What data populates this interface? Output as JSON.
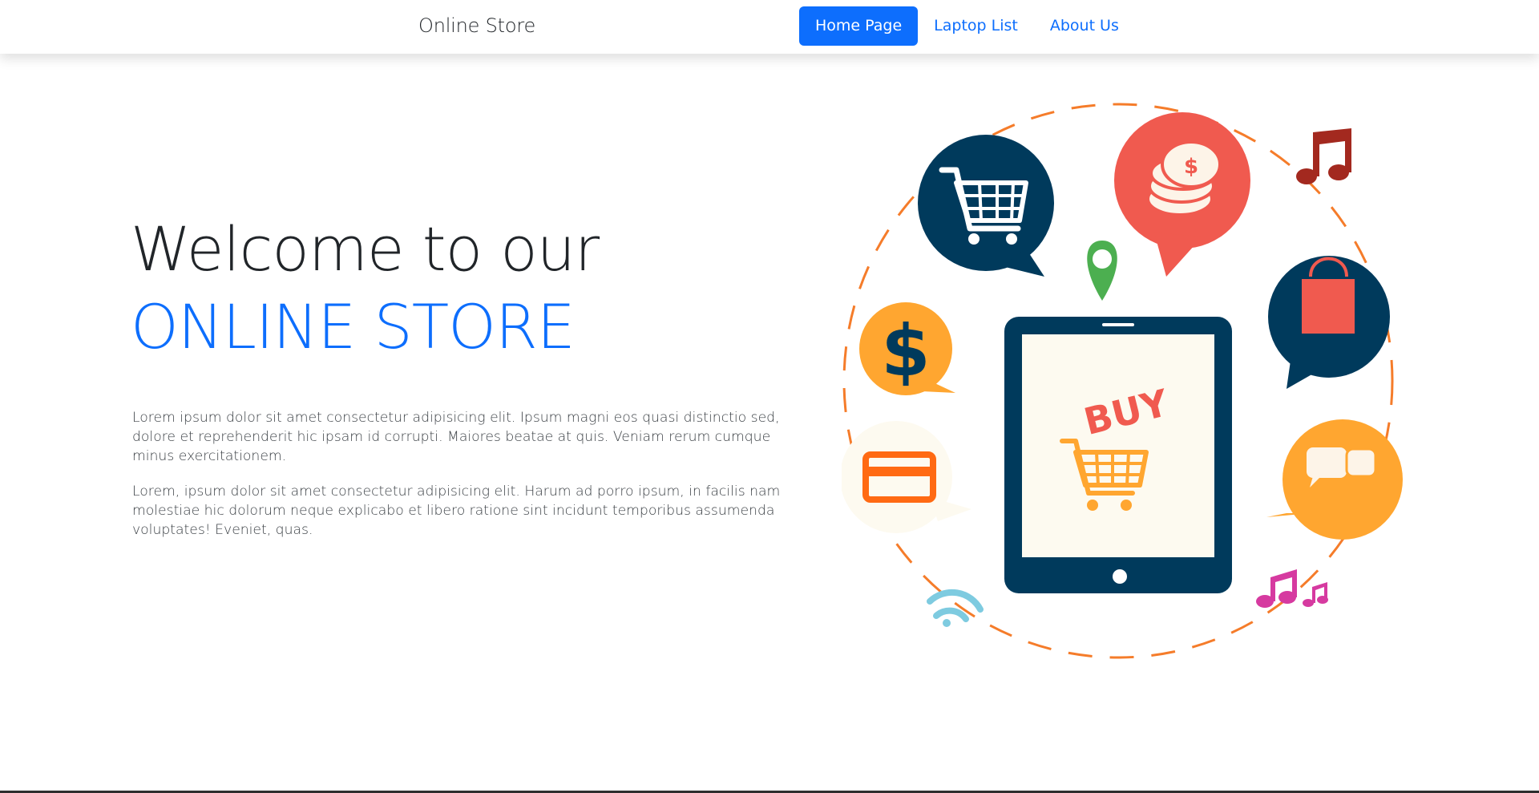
{
  "navbar": {
    "brand": "Online Store",
    "links": [
      {
        "label": "Home Page",
        "active": true
      },
      {
        "label": "Laptop List",
        "active": false
      },
      {
        "label": "About Us",
        "active": false
      }
    ]
  },
  "hero": {
    "title_line1": "Welcome to our",
    "title_line2": "ONLINE STORE",
    "paragraph1": "Lorem ipsum dolor sit amet consectetur adipisicing elit. Ipsum magni eos quasi distinctio sed, dolore et reprehenderit hic ipsam id corrupti. Maiores beatae at quis. Veniam rerum cumque minus exercitationem.",
    "paragraph2": "Lorem, ipsum dolor sit amet consectetur adipisicing elit. Harum ad porro ipsum, in facilis nam molestiae hic dolorum neque explicabo et libero ratione sint incidunt temporibus assumenda voluptates! Eveniet, quas."
  },
  "illustration": {
    "tablet_label": "BUY",
    "dollar_symbol": "$",
    "icons": [
      "shopping-cart-icon",
      "coins-icon",
      "music-note-icon",
      "location-pin-icon",
      "dollar-icon",
      "shopping-bag-icon",
      "credit-card-icon",
      "chat-bubbles-icon",
      "wifi-icon",
      "music-notes-icon",
      "tablet-icon"
    ]
  },
  "colors": {
    "primary": "#0d6efd",
    "navy": "#003a5c",
    "coral": "#f05a4f",
    "orange": "#ffa630",
    "dashed_ring": "#f57c2a",
    "green": "#4caf50"
  }
}
